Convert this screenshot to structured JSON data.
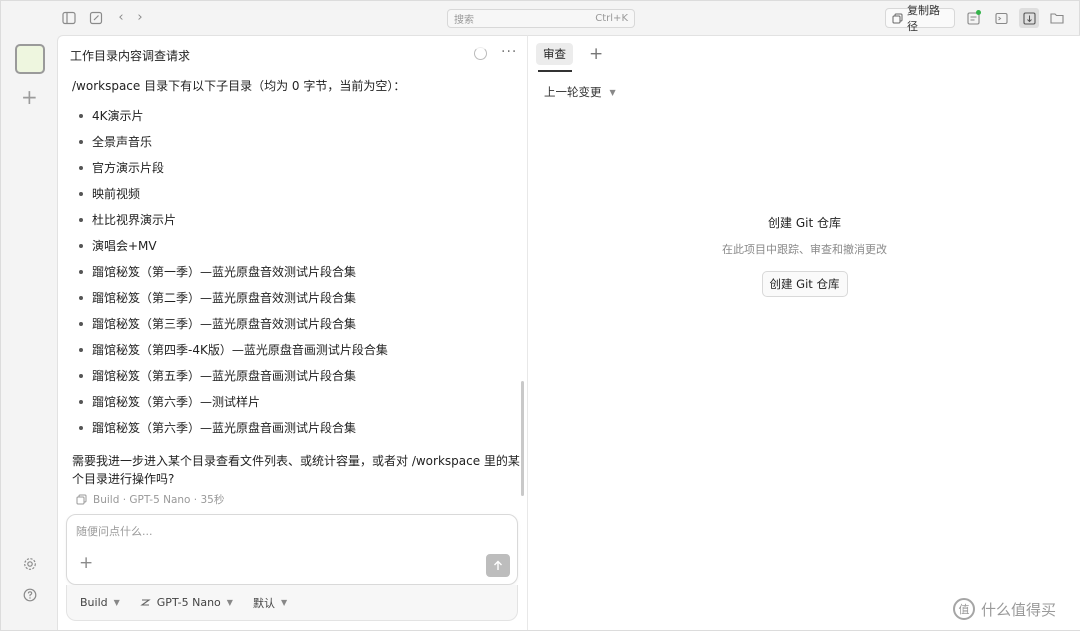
{
  "topbar": {
    "search_placeholder": "搜索",
    "search_shortcut": "Ctrl+K",
    "copy_path_label": "复制路径",
    "status_dot_color": "#34b34a"
  },
  "session": {
    "title": "工作目录内容调查请求",
    "intro": "/workspace 目录下有以下子目录（均为 0 字节，当前为空）：",
    "directories": [
      "4K演示片",
      "全景声音乐",
      "官方演示片段",
      "映前视频",
      "杜比视界演示片",
      "演唱会+MV",
      "蹓馆秘笈（第一季）—蓝光原盘音效测试片段合集",
      "蹓馆秘笈（第二季）—蓝光原盘音效测试片段合集",
      "蹓馆秘笈（第三季）—蓝光原盘音效测试片段合集",
      "蹓馆秘笈（第四季-4K版）—蓝光原盘音画测试片段合集",
      "蹓馆秘笈（第五季）—蓝光原盘音画测试片段合集",
      "蹓馆秘笈（第六季）—测试样片",
      "蹓馆秘笈（第六季）—蓝光原盘音画测试片段合集"
    ],
    "followup": "需要我进一步进入某个目录查看文件列表、或统计容量，或者对 /workspace 里的某个目录进行操作吗?",
    "meta": "Build · GPT-5 Nano · 35秒"
  },
  "composer": {
    "placeholder": "随便问点什么...",
    "value": "",
    "agent": "Build",
    "model": "GPT-5 Nano",
    "variant": "默认"
  },
  "review": {
    "tab_label": "审查",
    "diff_select": "上一轮变更",
    "empty_title": "创建 Git 仓库",
    "empty_subtitle": "在此项目中跟踪、审查和撤消更改",
    "create_button": "创建 Git 仓库"
  },
  "watermark": {
    "text": "什么值得买",
    "logo_glyph": "值"
  }
}
